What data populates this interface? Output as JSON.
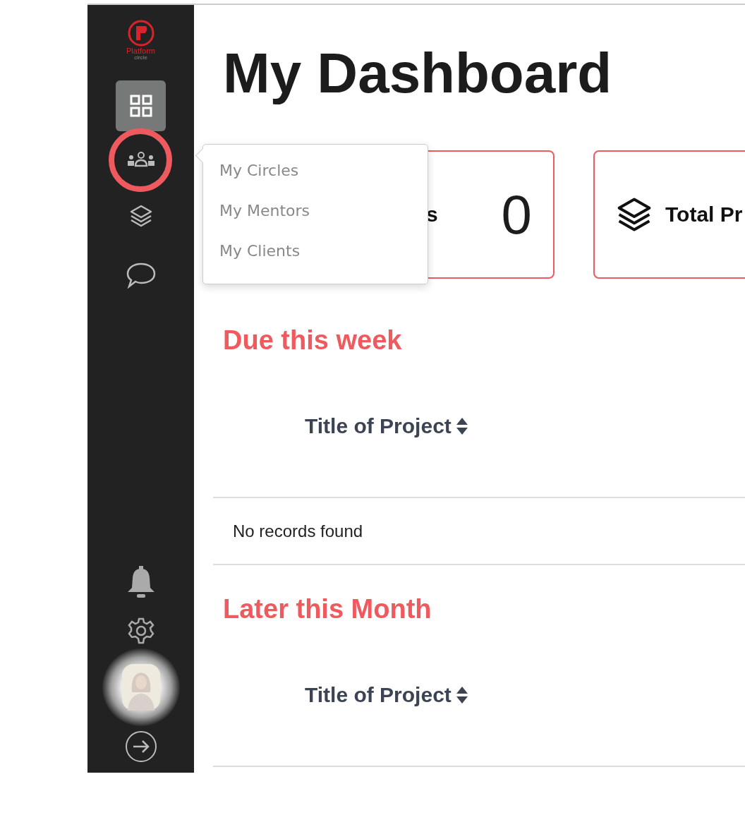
{
  "logo": {
    "name": "Platform",
    "tagline": "circle"
  },
  "sidebar": {
    "top_items": [
      {
        "kind": "dashboard",
        "selected": true
      },
      {
        "kind": "people",
        "selected": false,
        "highlighted": true
      },
      {
        "kind": "layers",
        "selected": false
      },
      {
        "kind": "chat",
        "selected": false
      }
    ],
    "bottom_items": [
      {
        "kind": "bell"
      },
      {
        "kind": "gear"
      },
      {
        "kind": "avatar"
      },
      {
        "kind": "logout"
      }
    ]
  },
  "title": "My Dashboard",
  "cards": [
    {
      "kind": "plain",
      "label": "s",
      "value": "0"
    },
    {
      "kind": "with_icon",
      "label": "Total Pr"
    }
  ],
  "dropdown": {
    "items": [
      "My Circles",
      "My Mentors",
      "My Clients"
    ]
  },
  "sections": [
    {
      "heading": "Due this week",
      "column": "Title of Project",
      "empty_text": "No records found"
    },
    {
      "heading": "Later this Month",
      "column": "Title of Project"
    }
  ]
}
